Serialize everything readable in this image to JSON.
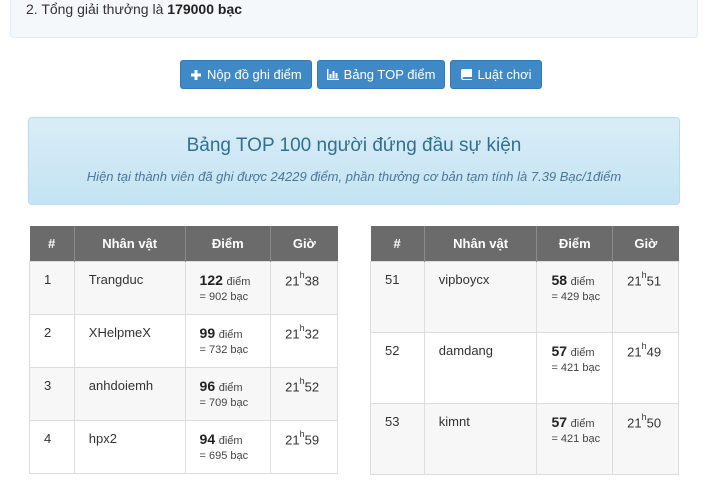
{
  "rules": {
    "line_prefix": "2. Tổng giải thưởng là ",
    "line_value": "179000 bạc"
  },
  "buttons": {
    "submit_label": "Nộp đồ ghi điểm",
    "top_label": "Bảng TOP điểm",
    "rules_label": "Luật chơi"
  },
  "banner": {
    "title": "Bảng TOP 100 người đứng đầu sự kiện",
    "subtitle": "Hiện tại thành viên đã ghi được 24229 điểm, phần thưởng cơ bản tạm tính là 7.39 Bạc/1điểm"
  },
  "table_headers": {
    "rank": "#",
    "name": "Nhân vật",
    "points": "Điểm",
    "time": "Giờ"
  },
  "points_word": "điểm",
  "reward_prefix": "= ",
  "left_rows": [
    {
      "rank": "1",
      "name": "Trangduc",
      "points": "122",
      "reward": "902 bạc",
      "hour": "21",
      "minute": "38"
    },
    {
      "rank": "2",
      "name": "XHelpmeX",
      "points": "99",
      "reward": "732 bạc",
      "hour": "21",
      "minute": "32"
    },
    {
      "rank": "3",
      "name": "anhdoiemh",
      "points": "96",
      "reward": "709 bạc",
      "hour": "21",
      "minute": "52"
    },
    {
      "rank": "4",
      "name": "hpx2",
      "points": "94",
      "reward": "695 bạc",
      "hour": "21",
      "minute": "59"
    }
  ],
  "right_rows": [
    {
      "rank": "51",
      "name": "vipboycx",
      "points": "58",
      "reward": "429 bạc",
      "hour": "21",
      "minute": "51"
    },
    {
      "rank": "52",
      "name": "damdang",
      "points": "57",
      "reward": "421 bạc",
      "hour": "21",
      "minute": "49"
    },
    {
      "rank": "53",
      "name": "kimnt",
      "points": "57",
      "reward": "421 bạc",
      "hour": "21",
      "minute": "50"
    }
  ]
}
